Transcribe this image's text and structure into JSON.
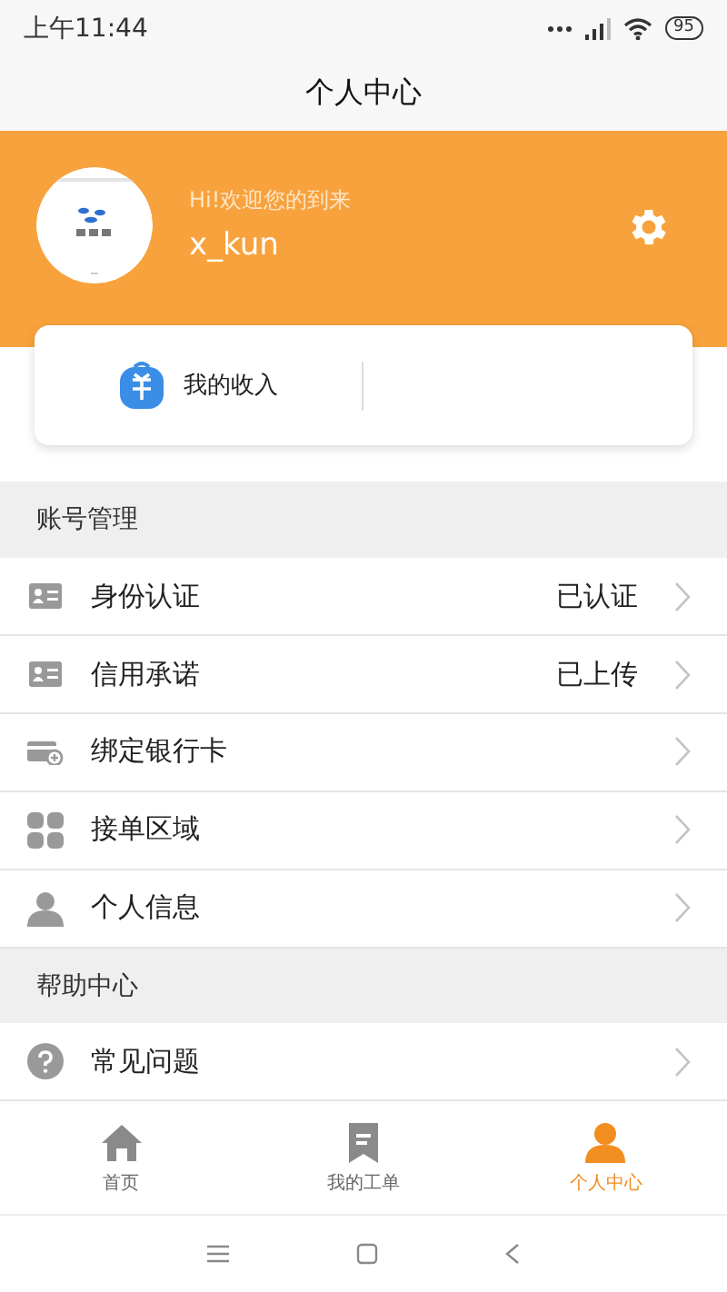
{
  "status_bar": {
    "time": "上午11:44",
    "battery": "95"
  },
  "title": "个人中心",
  "profile": {
    "greeting": "Hi!欢迎您的到来",
    "username": "x_kun"
  },
  "income": {
    "label": "我的收入"
  },
  "sections": [
    {
      "title": "账号管理",
      "items": [
        {
          "kind": "idcard",
          "label": "身份认证",
          "value": "已认证"
        },
        {
          "kind": "idcard",
          "label": "信用承诺",
          "value": "已上传"
        },
        {
          "kind": "bankcard",
          "label": "绑定银行卡"
        },
        {
          "kind": "grid",
          "label": "接单区域"
        },
        {
          "kind": "person",
          "label": "个人信息"
        }
      ]
    },
    {
      "title": "帮助中心",
      "items": [
        {
          "kind": "help",
          "label": "常见问题"
        }
      ]
    }
  ],
  "tabs": [
    {
      "kind": "home",
      "label": "首页",
      "selected": false
    },
    {
      "kind": "orders",
      "label": "我的工单",
      "selected": false
    },
    {
      "kind": "person",
      "label": "个人中心",
      "selected": true
    }
  ]
}
